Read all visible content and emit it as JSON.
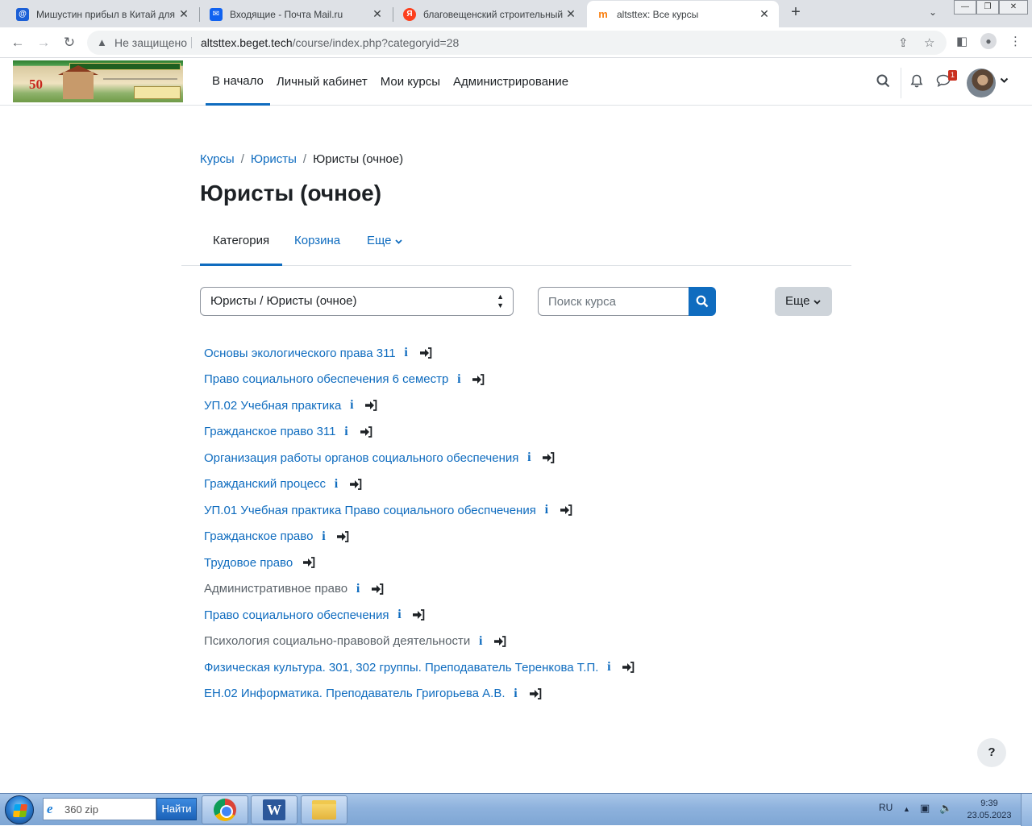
{
  "browser": {
    "tabs": [
      {
        "title": "Мишустин прибыл в Китай для",
        "favicon": "mail-ru-at-icon",
        "color": "#1b5fd6"
      },
      {
        "title": "Входящие - Почта Mail.ru",
        "favicon": "envelope-icon",
        "color": "#1062f0"
      },
      {
        "title": "благовещенский строительный",
        "favicon": "yandex-icon",
        "color": "#fc3f1d"
      },
      {
        "title": "altsttex: Все курсы",
        "favicon": "moodle-icon",
        "color": "#f98012"
      }
    ],
    "not_secure": "Не защищено",
    "url_host": "altsttex.beget.tech",
    "url_path": "/course/index.php?categoryid=28"
  },
  "navbar": {
    "links": [
      "В начало",
      "Личный кабинет",
      "Мои курсы",
      "Администрирование"
    ],
    "messages_badge": "1",
    "logo_text": "50"
  },
  "breadcrumb": {
    "items": [
      "Курсы",
      "Юристы"
    ],
    "current": "Юристы (очное)"
  },
  "page_title": "Юристы (очное)",
  "secondary_tabs": {
    "category": "Категория",
    "recycle": "Корзина",
    "more": "Еще"
  },
  "category_select": "Юристы / Юристы (очное)",
  "search": {
    "placeholder": "Поиск курса"
  },
  "more_button": "Еще",
  "courses": [
    {
      "name": "Основы экологического права 311",
      "info": true,
      "visible": true
    },
    {
      "name": "Право социального обеспечения 6 семестр",
      "info": true,
      "visible": true
    },
    {
      "name": "УП.02 Учебная практика",
      "info": true,
      "visible": true
    },
    {
      "name": "Гражданское право 311",
      "info": true,
      "visible": true
    },
    {
      "name": "Организация работы органов социального обеспечения",
      "info": true,
      "visible": true
    },
    {
      "name": "Гражданский процесс",
      "info": true,
      "visible": true
    },
    {
      "name": "УП.01 Учебная практика Право социального обеспчечения",
      "info": true,
      "visible": true
    },
    {
      "name": "Гражданское право",
      "info": true,
      "visible": true
    },
    {
      "name": "Трудовое право",
      "info": false,
      "visible": true
    },
    {
      "name": "Административное право",
      "info": true,
      "visible": false
    },
    {
      "name": "Право социального обеспечения",
      "info": true,
      "visible": true
    },
    {
      "name": "Психология социально-правовой деятельности",
      "info": true,
      "visible": false
    },
    {
      "name": "Физическая культура. 301, 302 группы. Преподаватель Теренкова Т.П.",
      "info": true,
      "visible": true
    },
    {
      "name": "ЕН.02 Информатика. Преподаватель Григорьева А.В.",
      "info": true,
      "visible": true
    }
  ],
  "help_button": "?",
  "taskbar": {
    "search_text": "360 zip",
    "find_button": "Найти",
    "lang": "RU",
    "time": "9:39",
    "date": "23.05.2023"
  },
  "colors": {
    "accent": "#0f6cbf",
    "dim_link": "#5b636a",
    "badge": "#ca3120"
  }
}
